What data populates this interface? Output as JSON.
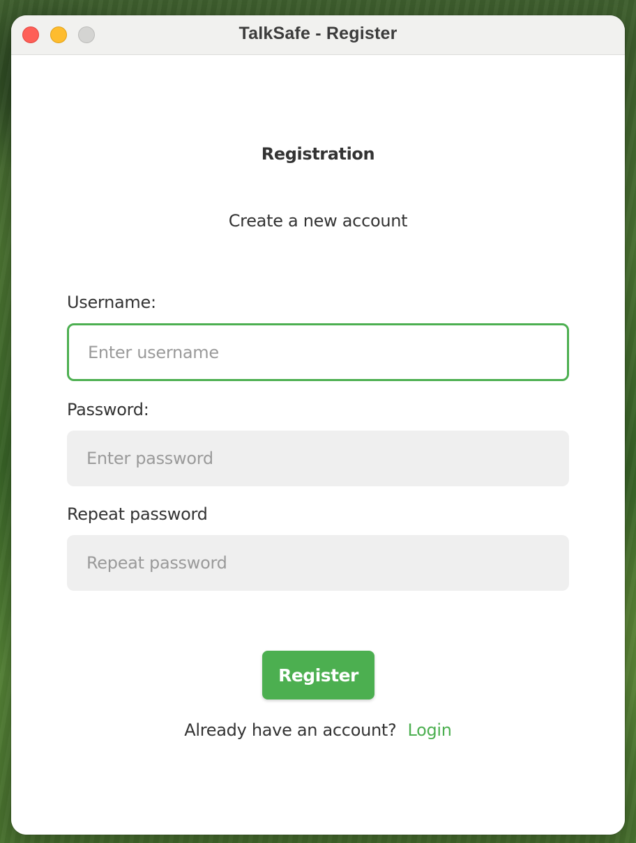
{
  "window": {
    "title": "TalkSafe - Register",
    "controls": {
      "close": "close-button",
      "minimize": "minimize-button",
      "zoom": "zoom-button"
    }
  },
  "form": {
    "heading": "Registration",
    "subheading": "Create a new account",
    "fields": [
      {
        "label": "Username:",
        "placeholder": "Enter username",
        "value": "",
        "focused": true
      },
      {
        "label": "Password:",
        "placeholder": "Enter password",
        "value": ""
      },
      {
        "label": "Repeat password",
        "placeholder": "Repeat password",
        "value": ""
      }
    ],
    "submit_label": "Register",
    "footer_text": "Already have an account?",
    "login_link": "Login"
  },
  "colors": {
    "accent": "#4caf50",
    "text": "#333333",
    "placeholder": "#9a9a9a",
    "input_bg": "#efefef",
    "close": "#fe5f57",
    "minimize": "#febc2e",
    "zoom": "#d4d4d2"
  }
}
